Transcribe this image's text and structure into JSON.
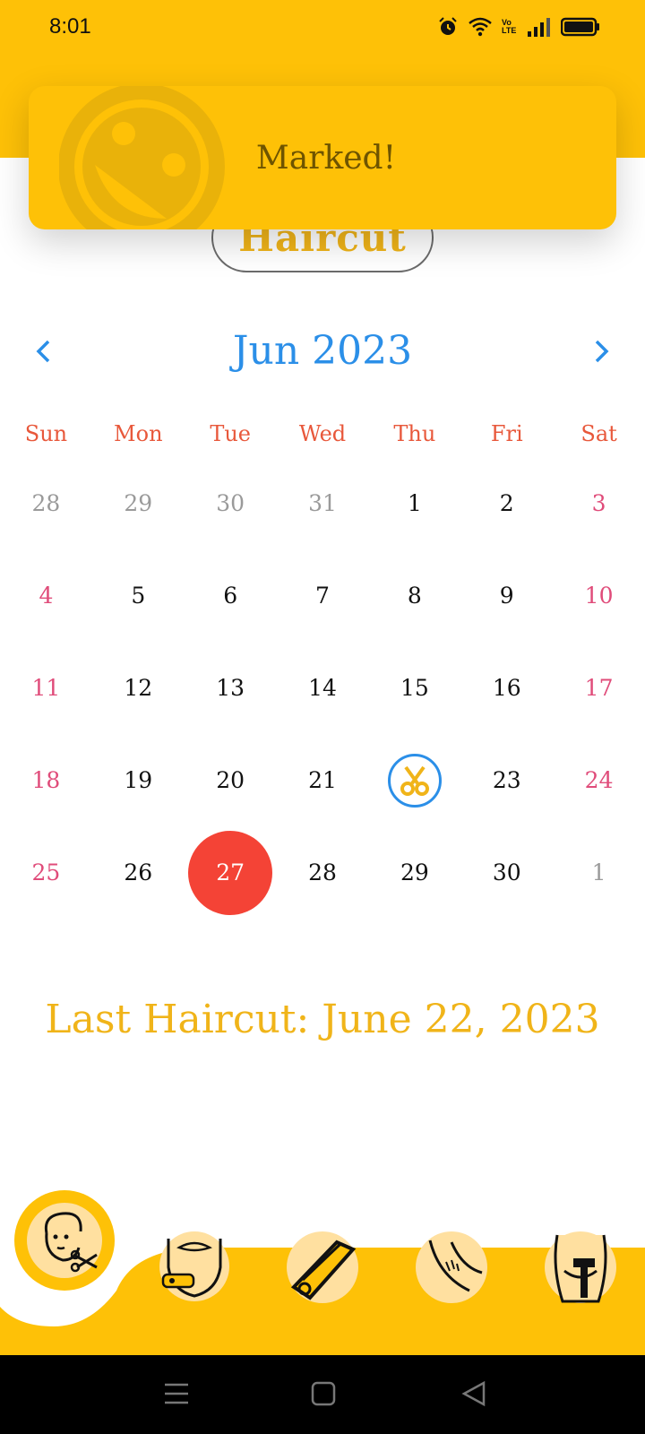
{
  "status": {
    "time": "8:01",
    "network_label": "Vo LTE"
  },
  "header": {
    "mode_label": "Haircut"
  },
  "toast": {
    "message": "Marked!"
  },
  "calendar": {
    "month_label": "Jun 2023",
    "weekdays": [
      "Sun",
      "Mon",
      "Tue",
      "Wed",
      "Thu",
      "Fri",
      "Sat"
    ],
    "days": [
      "28",
      "29",
      "30",
      "31",
      "1",
      "2",
      "3",
      "4",
      "5",
      "6",
      "7",
      "8",
      "9",
      "10",
      "11",
      "12",
      "13",
      "14",
      "15",
      "16",
      "17",
      "18",
      "19",
      "20",
      "21",
      "22",
      "23",
      "24",
      "25",
      "26",
      "27",
      "28",
      "29",
      "30",
      "1"
    ],
    "today": "27",
    "marked": "22"
  },
  "summary": {
    "last_haircut": "Last Haircut: June 22, 2023"
  },
  "colors": {
    "accent": "#FEC107",
    "blue": "#2B8FE8",
    "today": "#F44336",
    "weekday": "#E8583B",
    "weekend": "#E04C7A"
  },
  "bottom_nav": {
    "items": [
      "haircut-icon",
      "beard-icon",
      "trimmer-icon",
      "underarm-icon",
      "body-shave-icon"
    ]
  }
}
